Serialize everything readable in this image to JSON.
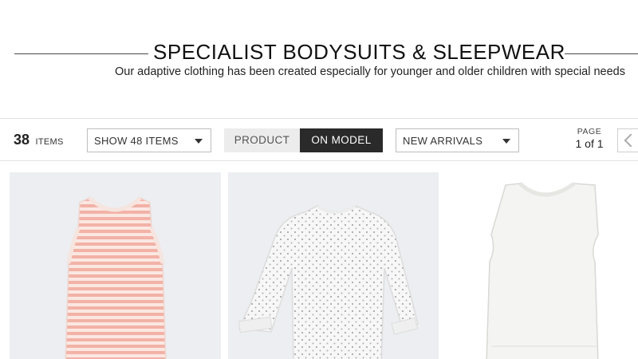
{
  "header": {
    "title": "SPECIALIST BODYSUITS & SLEEPWEAR",
    "subtitle": "Our adaptive clothing has been created especially for younger and older children with special needs"
  },
  "toolbar": {
    "item_count": "38",
    "item_count_label": "ITEMS",
    "show_select": {
      "selected": "SHOW 48 ITEMS"
    },
    "view_toggle": {
      "options": [
        "PRODUCT",
        "ON MODEL"
      ],
      "active": "ON MODEL"
    },
    "sort_select": {
      "selected": "NEW ARRIVALS"
    },
    "pager": {
      "label": "PAGE",
      "value": "1 of 1"
    }
  },
  "products": [
    {
      "image": "pink-striped-vest-bodysuit",
      "color": "#f2b8ad"
    },
    {
      "image": "white-spotted-long-sleeve-bodysuit",
      "color": "#f4f4f4"
    },
    {
      "image": "white-sleeveless-vest",
      "color": "#f5f5f3"
    }
  ],
  "colors": {
    "active_toggle": "#2a2a2a",
    "inactive_toggle": "#ececec",
    "card_bg": "#eceef1"
  },
  "icons": {
    "select_caret": "caret-down-icon",
    "pager_prev": "chevron-left-icon"
  }
}
